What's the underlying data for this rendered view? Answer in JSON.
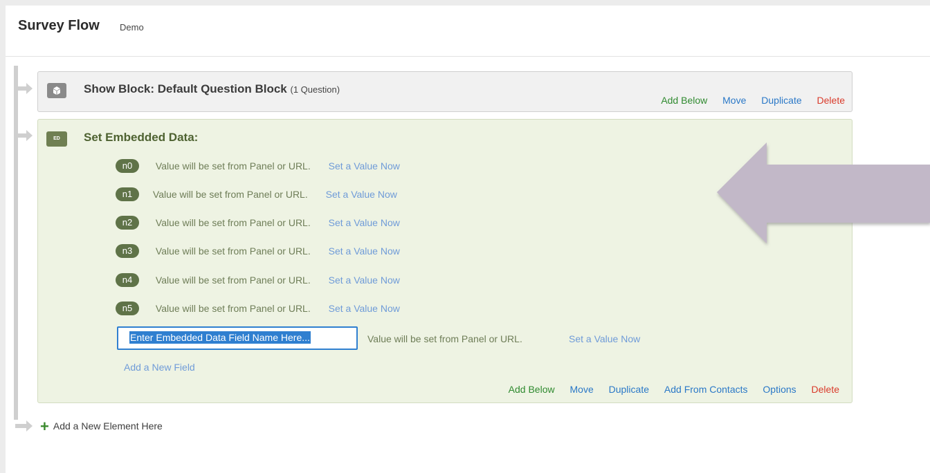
{
  "header": {
    "title": "Survey Flow",
    "subtitle": "Demo"
  },
  "show_block": {
    "title": "Show Block: Default Question Block",
    "count": "(1 Question)",
    "actions": {
      "add_below": "Add Below",
      "move": "Move",
      "duplicate": "Duplicate",
      "delete": "Delete"
    }
  },
  "ed_block": {
    "icon_label": "ED",
    "title": "Set Embedded Data:",
    "fields": [
      {
        "name": "n0",
        "text": "Value will be set from Panel or URL.",
        "link": "Set a Value Now"
      },
      {
        "name": "n1",
        "text": "Value will be set from Panel or URL.",
        "link": "Set a Value Now"
      },
      {
        "name": "n2",
        "text": "Value will be set from Panel or URL.",
        "link": "Set a Value Now"
      },
      {
        "name": "n3",
        "text": "Value will be set from Panel or URL.",
        "link": "Set a Value Now"
      },
      {
        "name": "n4",
        "text": "Value will be set from Panel or URL.",
        "link": "Set a Value Now"
      },
      {
        "name": "n5",
        "text": "Value will be set from Panel or URL.",
        "link": "Set a Value Now"
      }
    ],
    "new_field": {
      "value": "Enter Embedded Data Field Name Here...",
      "text": "Value will be set from Panel or URL.",
      "link": "Set a Value Now"
    },
    "add_field": "Add a New Field",
    "actions": {
      "add_below": "Add Below",
      "move": "Move",
      "duplicate": "Duplicate",
      "add_from_contacts": "Add From Contacts",
      "options": "Options",
      "delete": "Delete"
    }
  },
  "add_element": "Add a New Element Here",
  "colors": {
    "accent_green": "#2f8a2f",
    "link_blue": "#2a78c7",
    "delete_red": "#d93b2b",
    "ed_background": "#eef3e3",
    "arrow_fill": "#c2b8c8"
  }
}
